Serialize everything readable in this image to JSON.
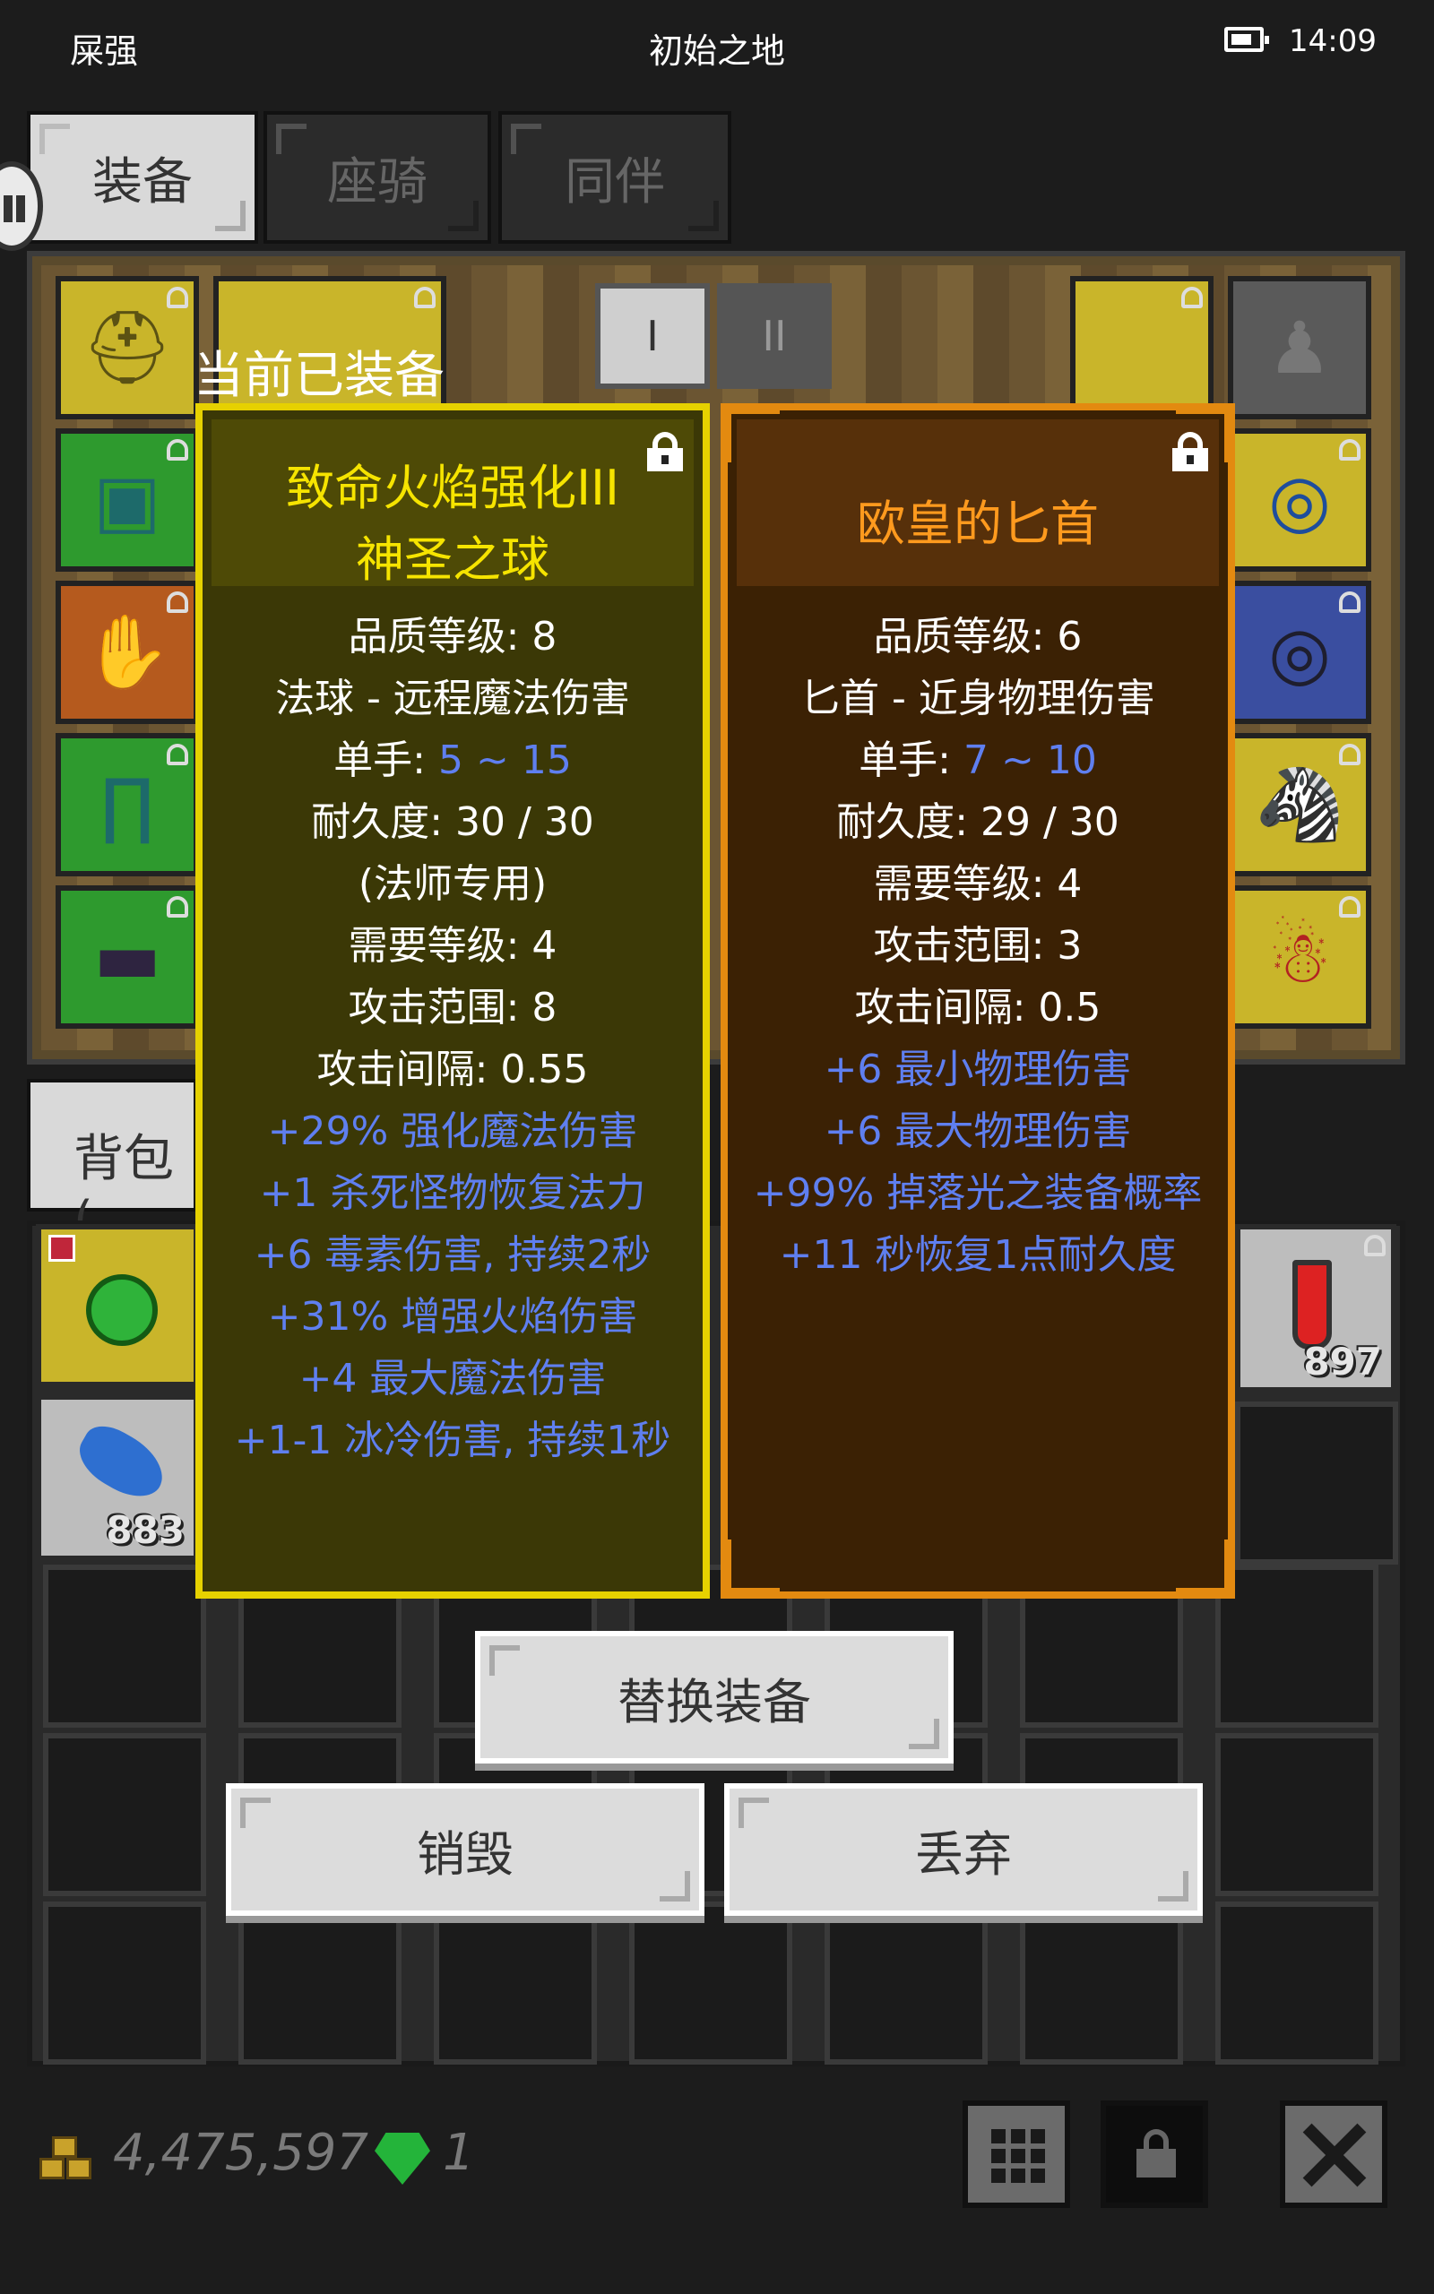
{
  "status_bar": {
    "left": "屎强",
    "title": "初始之地",
    "time": "14:09"
  },
  "tabs": [
    {
      "label": "装备",
      "active": true
    },
    {
      "label": "座骑",
      "active": false
    },
    {
      "label": "同伴",
      "active": false
    }
  ],
  "set_buttons": [
    "I",
    "II"
  ],
  "equipped_label": "当前已装备",
  "equipped_item": {
    "name_line1": "致命火焰强化III",
    "name_line2": "神圣之球",
    "stats": [
      {
        "text": "品质等级: 8"
      },
      {
        "text": "法球 - 远程魔法伤害"
      },
      {
        "prefix": "单手: ",
        "value": "5 ~ 15"
      },
      {
        "text": "耐久度: 30 / 30"
      },
      {
        "text": "(法师专用)"
      },
      {
        "text": "需要等级: 4"
      },
      {
        "text": "攻击范围: 8"
      },
      {
        "text": "攻击间隔: 0.55"
      }
    ],
    "affixes": [
      "+29% 强化魔法伤害",
      "+1 杀死怪物恢复法力",
      "+6 毒素伤害, 持续2秒",
      "+31% 增强火焰伤害",
      "+4 最大魔法伤害",
      "+1-1 冰冷伤害, 持续1秒"
    ]
  },
  "compare_item": {
    "name": "欧皇的匕首",
    "stats": [
      {
        "text": "品质等级: 6"
      },
      {
        "text": "匕首 - 近身物理伤害"
      },
      {
        "prefix": "单手: ",
        "value": "7 ~ 10"
      },
      {
        "text": "耐久度: 29 / 30"
      },
      {
        "text": "需要等级: 4"
      },
      {
        "text": "攻击范围: 3"
      },
      {
        "text": "攻击间隔: 0.5"
      }
    ],
    "affixes": [
      "+6 最小物理伤害",
      "+6 最大物理伤害",
      "+99% 掉落光之装备概率",
      "+11 秒恢复1点耐久度"
    ]
  },
  "bag": {
    "tab_label": "背包 (",
    "item_counts": {
      "feather": "883",
      "potion": "897"
    }
  },
  "actions": {
    "replace": "替换装备",
    "destroy": "销毁",
    "discard": "丢弃"
  },
  "footer": {
    "gold": "4,475,597",
    "gems": "1"
  },
  "colors": {
    "equipped_border": "#e6d100",
    "compare_border": "#e38a10",
    "affix_blue": "#5f7ff0"
  }
}
